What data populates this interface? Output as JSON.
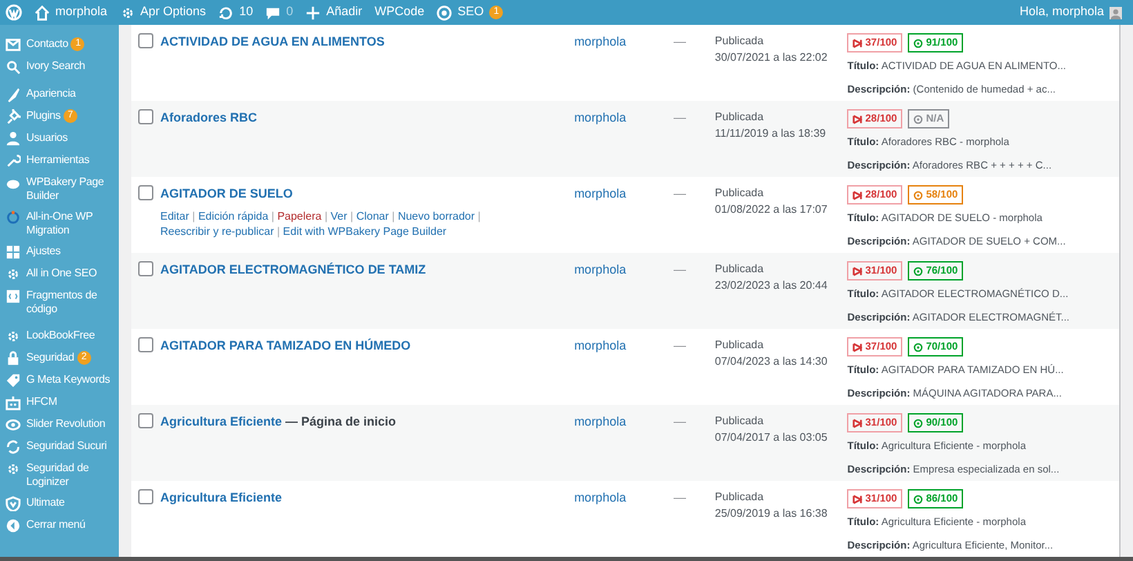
{
  "admin_bar": {
    "items": [
      {
        "kind": "logo"
      },
      {
        "kind": "home",
        "label": "morphola"
      },
      {
        "kind": "gear",
        "label": "Apr Options"
      },
      {
        "kind": "updates",
        "label": "10"
      },
      {
        "kind": "comments",
        "label": "0"
      },
      {
        "kind": "add",
        "label": "Añadir"
      },
      {
        "kind": "text",
        "label": "WPCode"
      },
      {
        "kind": "seo",
        "label": "SEO",
        "badge": "1"
      }
    ],
    "greeting": "Hola, morphola"
  },
  "sidebar": {
    "groups": [
      [
        {
          "kind": "mail",
          "label": "Contacto",
          "badge": "1"
        },
        {
          "kind": "search",
          "label": "Ivory Search"
        }
      ],
      [
        {
          "kind": "brush",
          "label": "Apariencia"
        },
        {
          "kind": "plug",
          "label": "Plugins",
          "badge": "7"
        },
        {
          "kind": "user",
          "label": "Usuarios"
        },
        {
          "kind": "wrench",
          "label": "Herramientas"
        },
        {
          "kind": "cloud",
          "label": "WPBakery Page Builder"
        },
        {
          "kind": "ring",
          "label": "All-in-One WP Migration"
        },
        {
          "kind": "grid",
          "label": "Ajustes"
        },
        {
          "kind": "gear",
          "label": "All in One SEO"
        },
        {
          "kind": "code",
          "label": "Fragmentos de código"
        }
      ],
      [
        {
          "kind": "gear",
          "label": "LookBookFree"
        },
        {
          "kind": "lock",
          "label": "Seguridad",
          "badge": "2"
        },
        {
          "kind": "tag",
          "label": "G Meta Keywords"
        },
        {
          "kind": "robot",
          "label": "HFCM"
        },
        {
          "kind": "eye",
          "label": "Slider Revolution"
        },
        {
          "kind": "sync",
          "label": "Seguridad Sucuri"
        },
        {
          "kind": "gear",
          "label": "Seguridad de Loginizer"
        },
        {
          "kind": "shield",
          "label": "Ultimate"
        },
        {
          "kind": "collapse",
          "label": "Cerrar menú"
        }
      ]
    ]
  },
  "rows": [
    {
      "checked": false,
      "title": "ACTIVIDAD DE AGUA EN ALIMENTOS",
      "author": "morphola",
      "column_3": "—",
      "status": "Publicada",
      "date": "30/07/2021 a las 22:02",
      "headline_score": "37/100",
      "seo_score": {
        "text": "91/100",
        "color": "#00a32a"
      },
      "title_label": "Título:",
      "seo_title": "ACTIVIDAD DE AGUA EN ALIMENTO...",
      "description_label": "Descripción:",
      "seo_description": "(Contenido de humedad + ac..."
    },
    {
      "checked": false,
      "title": "Aforadores RBC",
      "author": "morphola",
      "column_3": "—",
      "status": "Publicada",
      "date": "11/11/2019 a las 18:39",
      "headline_score": "28/100",
      "seo_score": {
        "text": "N/A",
        "color": "#8c8f94"
      },
      "title_label": "Título:",
      "seo_title": "Aforadores RBC - morphola",
      "description_label": "Descripción:",
      "seo_description": "Aforadores RBC + + + + + C..."
    },
    {
      "checked": false,
      "title": "AGITADOR DE SUELO",
      "actions": [
        {
          "label": "Editar",
          "kind": "link"
        },
        {
          "label": "|",
          "kind": "separator"
        },
        {
          "label": "Edición rápida",
          "kind": "link"
        },
        {
          "label": "|",
          "kind": "separator"
        },
        {
          "label": "Papelera",
          "kind": "trash"
        },
        {
          "label": "|",
          "kind": "separator"
        },
        {
          "label": "Ver",
          "kind": "link"
        },
        {
          "label": "|",
          "kind": "separator"
        },
        {
          "label": "Clonar",
          "kind": "link"
        },
        {
          "label": "|",
          "kind": "separator"
        },
        {
          "label": "Nuevo borrador",
          "kind": "link"
        },
        {
          "label": "|",
          "kind": "separator"
        },
        {
          "label": "Reescribir y re-publicar",
          "kind": "link"
        },
        {
          "label": "|",
          "kind": "separator"
        },
        {
          "label": "Edit with WPBakery Page Builder",
          "kind": "link"
        }
      ],
      "author": "morphola",
      "column_3": "—",
      "status": "Publicada",
      "date": "01/08/2022 a las 17:07",
      "headline_score": "28/100",
      "seo_score": {
        "text": "58/100",
        "color": "#e6820e"
      },
      "title_label": "Título:",
      "seo_title": "AGITADOR DE SUELO - morphola",
      "description_label": "Descripción:",
      "seo_description": "AGITADOR DE SUELO + COM..."
    },
    {
      "checked": false,
      "title": "AGITADOR ELECTROMAGNÉTICO DE TAMIZ",
      "author": "morphola",
      "column_3": "—",
      "status": "Publicada",
      "date": "23/02/2023 a las 20:44",
      "headline_score": "31/100",
      "seo_score": {
        "text": "76/100",
        "color": "#00a32a"
      },
      "title_label": "Título:",
      "seo_title": "AGITADOR ELECTROMAGNÉTICO D...",
      "description_label": "Descripción:",
      "seo_description": "AGITADOR ELECTROMAGNÉT..."
    },
    {
      "checked": false,
      "title": "AGITADOR PARA TAMIZADO EN HÚMEDO",
      "author": "morphola",
      "column_3": "—",
      "status": "Publicada",
      "date": "07/04/2023 a las 14:30",
      "headline_score": "37/100",
      "seo_score": {
        "text": "70/100",
        "color": "#00a32a"
      },
      "title_label": "Título:",
      "seo_title": "AGITADOR PARA TAMIZADO EN HÚ...",
      "description_label": "Descripción:",
      "seo_description": "MÁQUINA AGITADORA PARA..."
    },
    {
      "checked": false,
      "title": "Agricultura Eficiente",
      "post_state": "— Página de inicio",
      "author": "morphola",
      "column_3": "—",
      "status": "Publicada",
      "date": "07/04/2017 a las 03:05",
      "headline_score": "31/100",
      "seo_score": {
        "text": "90/100",
        "color": "#00a32a"
      },
      "title_label": "Título:",
      "seo_title": "Agricultura Eficiente - morphola",
      "description_label": "Descripción:",
      "seo_description": "Empresa especializada en sol..."
    },
    {
      "checked": false,
      "title": "Agricultura Eficiente",
      "author": "morphola",
      "column_3": "—",
      "status": "Publicada",
      "date": "25/09/2019 a las 16:38",
      "headline_score": "31/100",
      "seo_score": {
        "text": "86/100",
        "color": "#00a32a"
      },
      "title_label": "Título:",
      "seo_title": "Agricultura Eficiente - morphola",
      "description_label": "Descripción:",
      "seo_description": "Agricultura Eficiente, Monitor..."
    }
  ]
}
